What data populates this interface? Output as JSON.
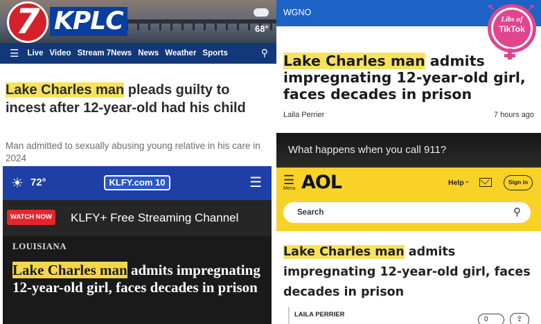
{
  "kplc": {
    "logo_number": "7",
    "logo_text": "KPLC",
    "temperature": "68°",
    "nav": [
      "Live",
      "Video",
      "Stream 7News",
      "News",
      "Weather",
      "Sports"
    ],
    "headline_highlight": "Lake Charles man",
    "headline_rest": " pleads guilty to incest after 12-year-old had his child",
    "subhead": "Man admitted to sexually abusing young relative in his care in 2024"
  },
  "klfy": {
    "temperature": "72°",
    "logo_text": "KLFY.com 10",
    "watch_label": "WATCH NOW",
    "stream_label": "KLFY+ Free Streaming Channel",
    "section": "LOUISIANA",
    "headline_highlight": "Lake Charles man",
    "headline_rest": " admits impregnating 12-year-old girl, faces decades in prison"
  },
  "wgno": {
    "station": "WGNO",
    "headline_highlight": "Lake Charles man",
    "headline_rest": " admits impregnating 12-year-old girl, faces decades in prison",
    "author": "Laila Perrier",
    "time": "7 hours ago"
  },
  "badge": {
    "line1": "Libs of",
    "line2": "TikTok"
  },
  "video": {
    "caption": "What happens when you call 911?"
  },
  "aol": {
    "menu_label": "Menu",
    "logo": "AOL",
    "help": "Help",
    "signin": "Sign in",
    "search_placeholder": "Search",
    "headline_highlight": "Lake Charles man",
    "headline_rest": " admits impregnating 12-year-old girl, faces decades in prison",
    "author": "LAILA PERRIER",
    "comments_count": "0"
  },
  "colors": {
    "highlight": "#f7e25c",
    "kplc_red": "#d4212a",
    "kplc_blue": "#12377a",
    "klfy_blue": "#1d3fa6",
    "wgno_blue": "#1d62c6",
    "aol_yellow": "#f9d227",
    "badge_pink": "#e0458f"
  },
  "icons": [
    "menu-icon",
    "search-icon",
    "cloud-icon",
    "sun-icon",
    "mail-icon",
    "chevron-down-icon",
    "comment-icon",
    "share-icon"
  ]
}
